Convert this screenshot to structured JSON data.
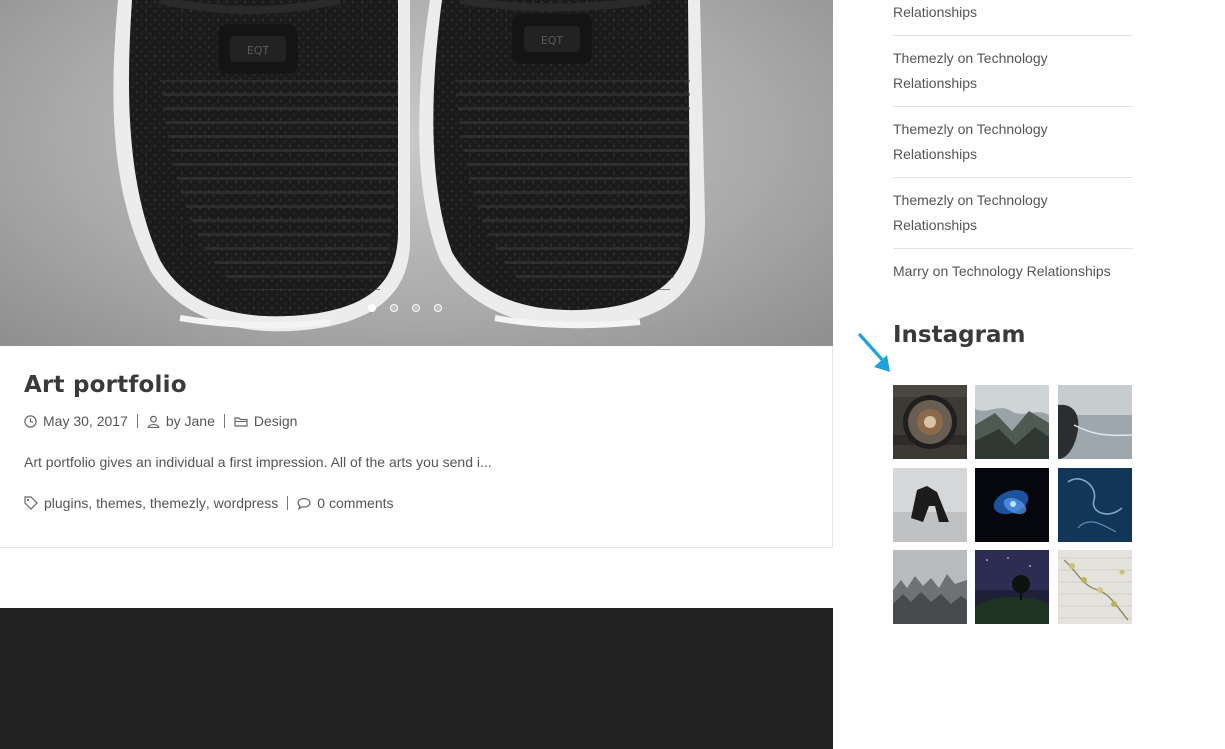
{
  "slider": {
    "dots": [
      "slide-1",
      "slide-2",
      "slide-3",
      "slide-4"
    ],
    "active_index": 0,
    "shoe_label": "EQT"
  },
  "post": {
    "title": "Art portfolio",
    "date": "May 30, 2017",
    "author": "by Jane",
    "category": "Design",
    "excerpt": "Art portfolio gives an individual a first impression. All of the arts you send i...",
    "tags": [
      "plugins",
      "themes",
      "themezly",
      "wordpress"
    ],
    "tag_separator": ",",
    "comments": "0 comments"
  },
  "sidebar": {
    "recent_comments": [
      {
        "author": "",
        "on": "",
        "post": "Relationships"
      },
      {
        "author": "Themezly",
        "on": "on",
        "post": "Technology Relationships"
      },
      {
        "author": "Themezly",
        "on": "on",
        "post": "Technology Relationships"
      },
      {
        "author": "Themezly",
        "on": "on",
        "post": "Technology Relationships"
      },
      {
        "author": "Marry",
        "on": "on",
        "post": "Technology Relationships"
      }
    ],
    "instagram_title": "Instagram",
    "instagram_photos": [
      "coffee-cup-photo",
      "mountain-valley-photo",
      "coastal-road-photo",
      "sea-arch-rock-photo",
      "blue-flower-photo",
      "jellyfish-photo",
      "misty-forest-photo",
      "night-tree-photo",
      "vine-wall-photo"
    ]
  },
  "annotation": {
    "arrow_color": "#1aa3e0"
  },
  "colors": {
    "footer": "#212121",
    "heading": "#3a3a3a",
    "text": "#555555"
  }
}
